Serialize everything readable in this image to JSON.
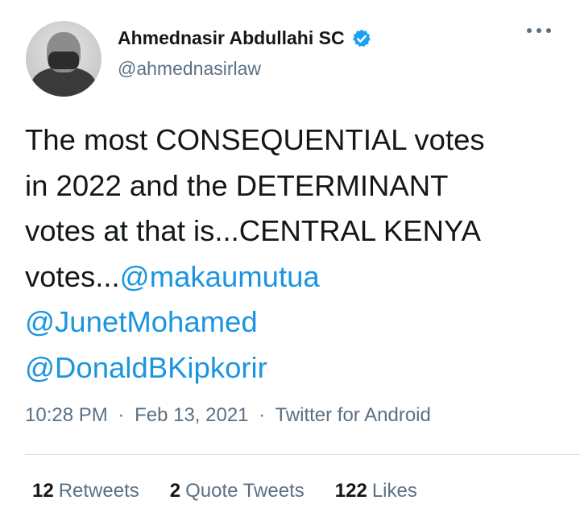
{
  "author": {
    "display_name": "Ahmednasir Abdullahi SC",
    "handle": "@ahmednasirlaw",
    "verified_icon": "verified-badge-icon"
  },
  "tweet": {
    "text_1": "The most CONSEQUENTIAL votes",
    "text_2": "in 2022 and the DETERMINANT",
    "text_3": "votes at that is...CENTRAL KENYA",
    "text_4": "votes...",
    "mentions": [
      "@makaumutua",
      "@JunetMohamed",
      "@DonaldBKipkorir"
    ]
  },
  "meta": {
    "time": "10:28 PM",
    "date": "Feb 13, 2021",
    "source": "Twitter for Android",
    "separator": "·"
  },
  "stats": {
    "retweets_count": "12",
    "retweets_label": "Retweets",
    "quotes_count": "2",
    "quotes_label": "Quote Tweets",
    "likes_count": "122",
    "likes_label": "Likes"
  },
  "colors": {
    "link": "#1b95e0",
    "secondary_text": "#5b7083",
    "verified": "#1da1f2"
  }
}
